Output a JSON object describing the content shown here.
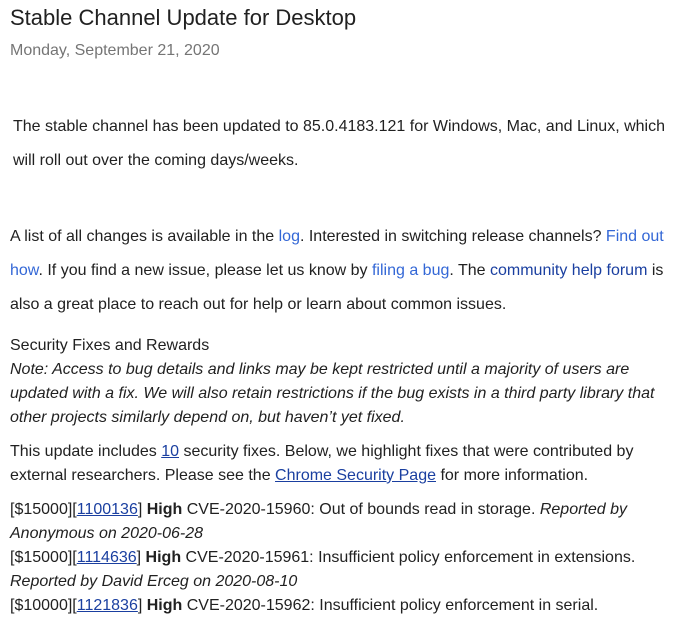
{
  "post": {
    "title": "Stable Channel Update for Desktop",
    "date": "Monday, September 21, 2020"
  },
  "intro": {
    "text": "The stable channel has been updated to 85.0.4183.121 for Windows, Mac, and Linux, which will roll out over the coming days/weeks."
  },
  "changes": {
    "t1": "A list of all changes is available in the ",
    "log_link": "log",
    "t2": ". Interested in switching release channels? ",
    "find_out_link": "Find out how",
    "t3": ". If you find a new issue, please let us know by ",
    "filing_link": "filing a bug",
    "t4": ". The ",
    "forum_link": "community help forum",
    "t5": " is also a great place to reach out for help or learn about common issues."
  },
  "security": {
    "heading": "Security Fixes and Rewards",
    "note": "Note: Access to bug details and links may be kept restricted until a majority of users are updated with a fix. We will also retain restrictions if the bug exists in a third party library that other projects similarly depend on, but haven’t yet fixed.",
    "includes_t1": "This update includes ",
    "fix_count_link": "10",
    "includes_t2": " security fixes. Below, we highlight fixes that were contributed by external researchers. Please see the ",
    "security_page_link": "Chrome Security Page",
    "includes_t3": " for more information."
  },
  "fixes": [
    {
      "reward": "[$15000][",
      "bug_id": "1100136",
      "close": "] ",
      "severity": "High",
      "description": " CVE-2020-15960: Out of bounds read in storage. ",
      "reporter": "Reported by Anonymous on 2020-06-28"
    },
    {
      "reward": "[$15000][",
      "bug_id": "1114636",
      "close": "] ",
      "severity": "High",
      "description": " CVE-2020-15961: Insufficient policy enforcement in extensions. ",
      "reporter": "Reported by David Erceg on 2020-08-10"
    },
    {
      "reward": "[$10000][",
      "bug_id": "1121836",
      "close": "] ",
      "severity": "High",
      "description": " CVE-2020-15962: Insufficient policy enforcement in serial.",
      "reporter": ""
    }
  ]
}
